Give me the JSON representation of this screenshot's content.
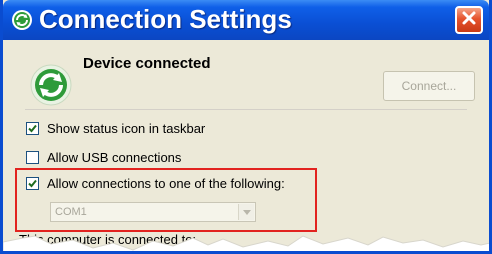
{
  "window": {
    "title": "Connection Settings",
    "title_icon": "sync-icon",
    "close_icon": "close-icon"
  },
  "device": {
    "icon": "device-sync-icon",
    "status": "Device connected",
    "connect_label": "Connect..."
  },
  "options": {
    "show_status_icon": {
      "label": "Show status icon in taskbar",
      "checked": true
    },
    "allow_usb": {
      "label": "Allow USB connections",
      "checked": false
    },
    "allow_connections": {
      "label": "Allow connections to one of the following:",
      "checked": true
    }
  },
  "port_select": {
    "value": "COM1"
  },
  "computer_connected_label": "This computer is connected to:",
  "colors": {
    "titlebar": "#0a4fd4",
    "highlight_border": "#e2231f",
    "window_bg": "#ece9d8",
    "icon_green": "#2e9b3a"
  }
}
